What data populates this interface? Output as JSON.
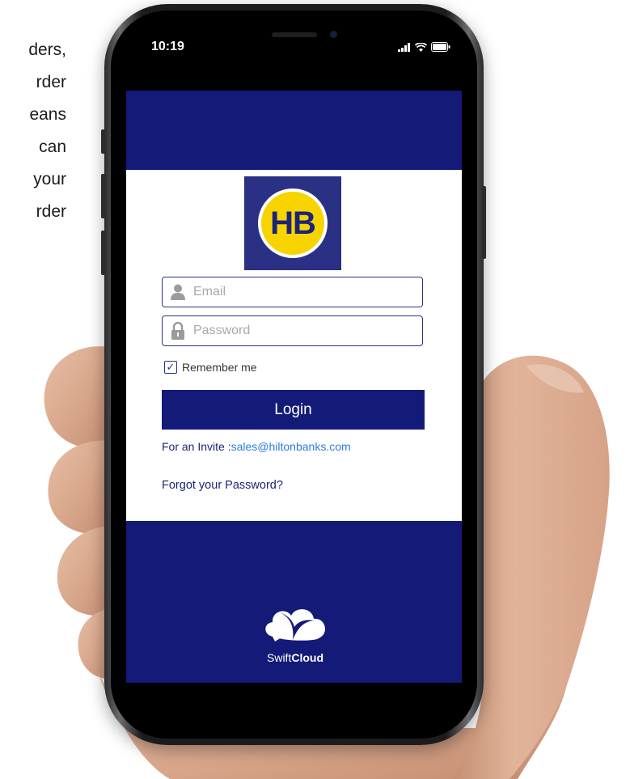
{
  "background_text": {
    "lines": [
      "ders,",
      "rder",
      "eans",
      "can",
      "your",
      "rder"
    ]
  },
  "status_bar": {
    "time": "10:19",
    "icons": [
      "signal-icon",
      "wifi-icon",
      "battery-icon"
    ]
  },
  "login": {
    "logo_text": "HB",
    "email_placeholder": "Email",
    "password_placeholder": "Password",
    "remember_label": "Remember me",
    "remember_checked": true,
    "login_button": "Login",
    "invite_prefix": "For an Invite :",
    "invite_email": "sales@hiltonbanks.com",
    "forgot_password": "Forgot your Password?"
  },
  "footer": {
    "brand_light": "Swift",
    "brand_bold": "Cloud"
  },
  "colors": {
    "navy": "#141a78",
    "logo_yellow": "#f7d400",
    "link_blue": "#2d7ae0"
  }
}
